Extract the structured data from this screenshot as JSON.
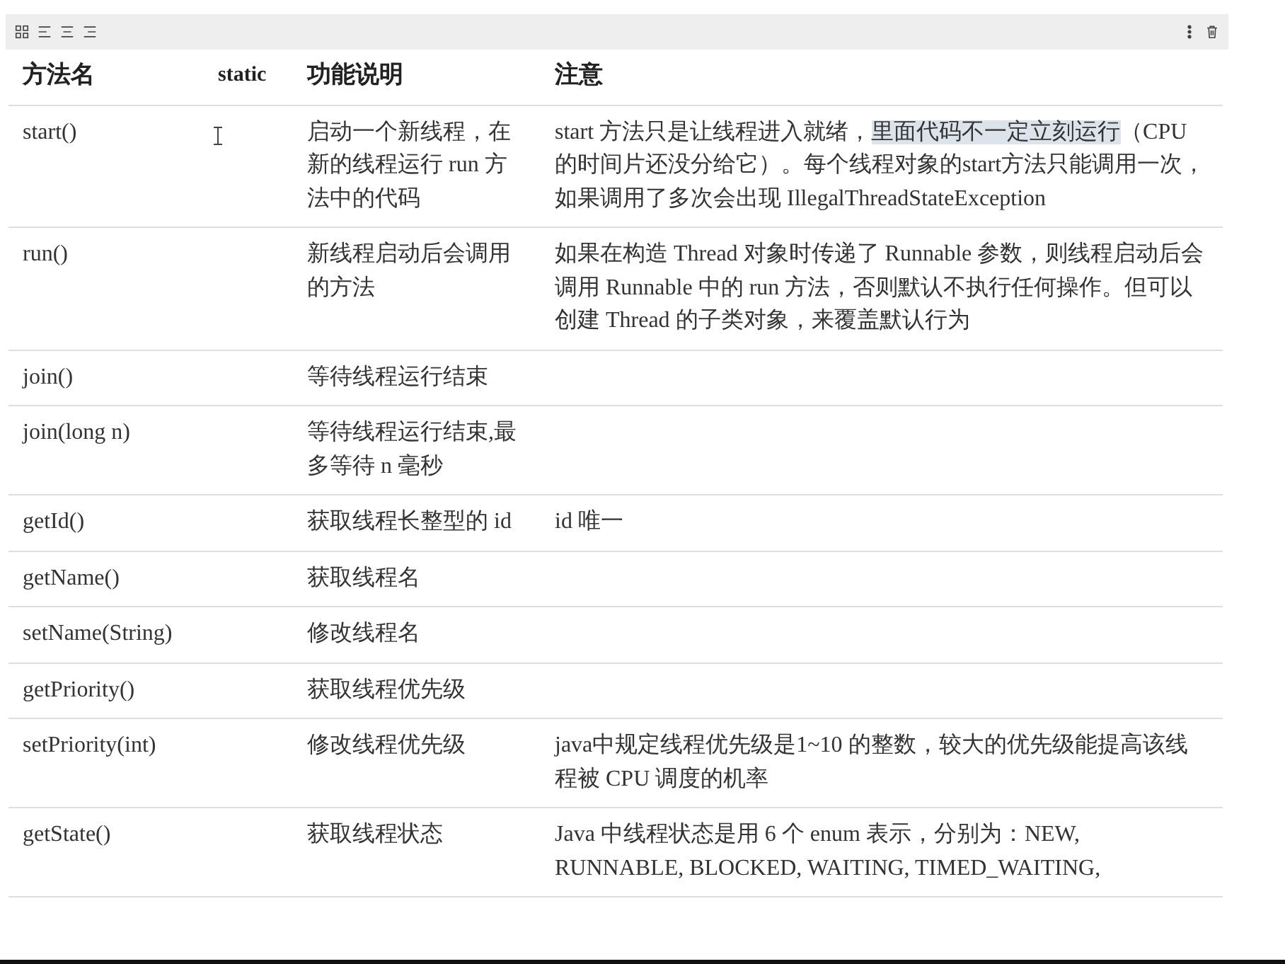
{
  "table": {
    "columns": [
      "方法名",
      "static",
      "功能说明",
      "注意"
    ],
    "rows": [
      {
        "cells": [
          "start()",
          "",
          "启动一个新线程，在新的线程运行 run 方法中的代码"
        ],
        "note": [
          {
            "text": "start 方法只是让线程进入就绪，",
            "selected": false
          },
          {
            "text": "里面代码不一定立刻运行",
            "selected": true
          },
          {
            "text": "（CPU 的时间片还没分给它）。每个线程对象的start方法只能调用一次，如果调用了多次会出现 IllegalThreadStateException",
            "selected": false
          }
        ],
        "cursor": true
      },
      {
        "cells": [
          "run()",
          "",
          "新线程启动后会调用的方法"
        ],
        "note": [
          {
            "text": "如果在构造 Thread 对象时传递了 Runnable 参数，则线程启动后会调用 Runnable 中的 run 方法，否则默认不执行任何操作。但可以创建 Thread 的子类对象，来覆盖默认行为",
            "selected": false
          }
        ]
      },
      {
        "cells": [
          "join()",
          "",
          "等待线程运行结束"
        ]
      },
      {
        "cells": [
          "join(long n)",
          "",
          "等待线程运行结束,最多等待 n 毫秒"
        ]
      },
      {
        "cells": [
          "getId()",
          "",
          "获取线程长整型的 id"
        ],
        "note": [
          {
            "text": "id 唯一",
            "selected": false
          }
        ]
      },
      {
        "cells": [
          "getName()",
          "",
          "获取线程名"
        ]
      },
      {
        "cells": [
          "setName(String)",
          "",
          "修改线程名"
        ]
      },
      {
        "cells": [
          "getPriority()",
          "",
          "获取线程优先级"
        ]
      },
      {
        "cells": [
          "setPriority(int)",
          "",
          "修改线程优先级"
        ],
        "note": [
          {
            "text": "java中规定线程优先级是1~10 的整数，较大的优先级能提高该线程被 CPU 调度的机率",
            "selected": false
          }
        ]
      },
      {
        "cells": [
          "getState()",
          "",
          "获取线程状态"
        ],
        "note": [
          {
            "text": "Java 中线程状态是用 6 个 enum 表示，分别为：NEW, RUNNABLE, BLOCKED, WAITING, TIMED_WAITING,",
            "selected": false
          }
        ]
      }
    ]
  }
}
